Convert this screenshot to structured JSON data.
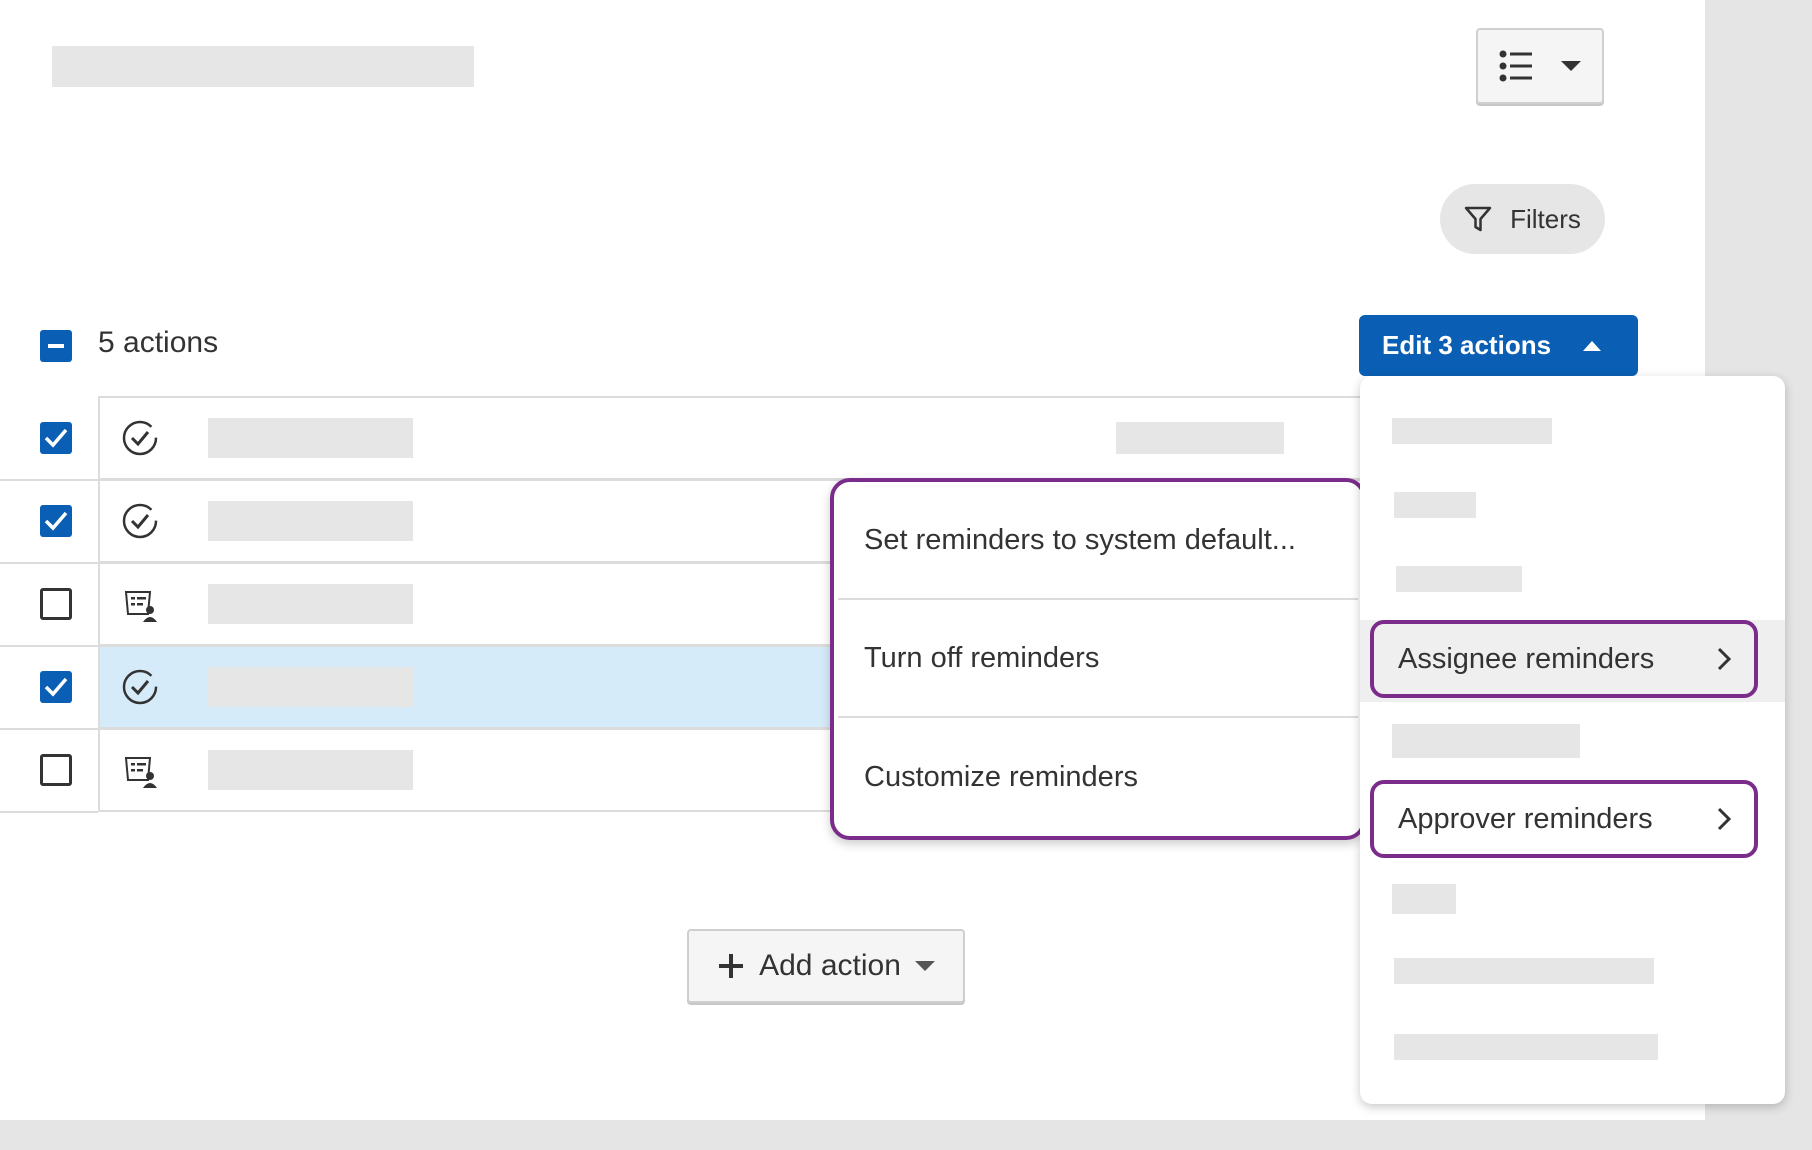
{
  "toolbar": {
    "view_toggle_icon": "list-view-icon",
    "filters_label": "Filters"
  },
  "actions_header": {
    "count_label": "5 actions",
    "edit_button_label": "Edit 3 actions"
  },
  "rows": [
    {
      "checked": true,
      "icon": "approval-check-icon",
      "highlighted": false
    },
    {
      "checked": true,
      "icon": "approval-check-icon",
      "highlighted": false
    },
    {
      "checked": false,
      "icon": "form-task-icon",
      "highlighted": false
    },
    {
      "checked": true,
      "icon": "approval-check-icon",
      "highlighted": true
    },
    {
      "checked": false,
      "icon": "form-task-icon",
      "highlighted": false
    }
  ],
  "add_action": {
    "label": "Add action"
  },
  "submenu": {
    "items": [
      {
        "label": "Set reminders to system default..."
      },
      {
        "label": "Turn off reminders"
      },
      {
        "label": "Customize reminders"
      }
    ]
  },
  "dropdown": {
    "assignee_label": "Assignee reminders",
    "approver_label": "Approver reminders"
  },
  "colors": {
    "accent": "#0a5fb4",
    "highlight_outline": "#7b2c8b",
    "selected_row": "#d6ebfa"
  }
}
